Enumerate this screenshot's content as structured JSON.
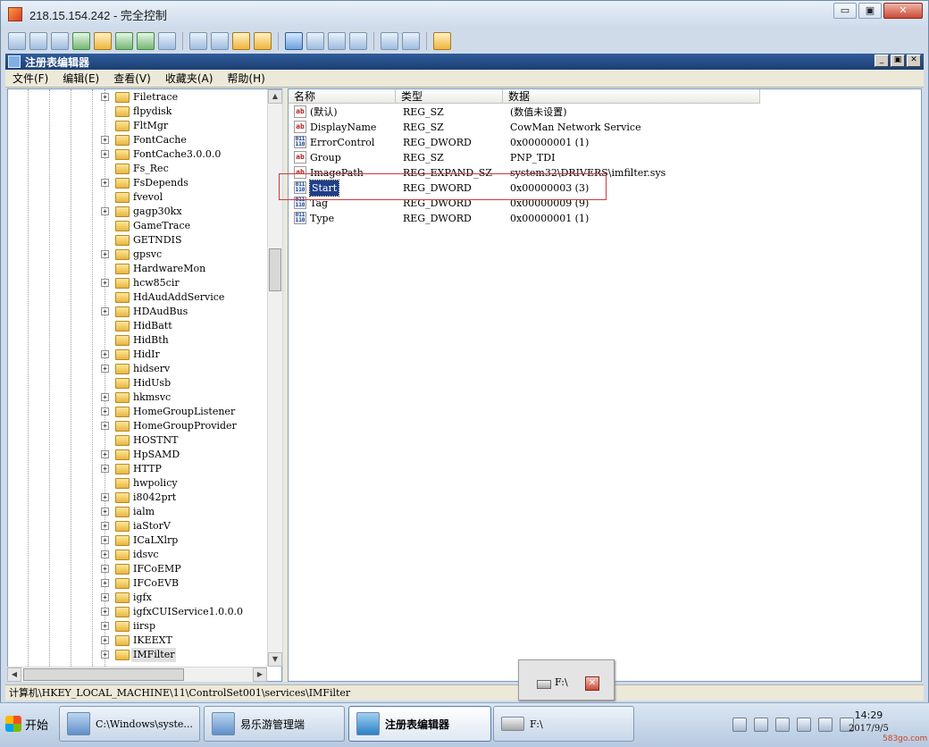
{
  "outer_window": {
    "title": "218.15.154.242 - 完全控制",
    "controls": {
      "minimize": "▭",
      "restore": "▣",
      "close": "✕"
    }
  },
  "inner_window": {
    "title": "注册表编辑器",
    "controls": {
      "minimize": "_",
      "restore": "▣",
      "close": "✕"
    }
  },
  "menu": [
    "文件(F)",
    "编辑(E)",
    "查看(V)",
    "收藏夹(A)",
    "帮助(H)"
  ],
  "tree": {
    "items": [
      {
        "label": "Filetrace",
        "expandable": true
      },
      {
        "label": "flpydisk",
        "expandable": false
      },
      {
        "label": "FltMgr",
        "expandable": false
      },
      {
        "label": "FontCache",
        "expandable": true
      },
      {
        "label": "FontCache3.0.0.0",
        "expandable": true
      },
      {
        "label": "Fs_Rec",
        "expandable": false
      },
      {
        "label": "FsDepends",
        "expandable": true
      },
      {
        "label": "fvevol",
        "expandable": false
      },
      {
        "label": "gagp30kx",
        "expandable": true
      },
      {
        "label": "GameTrace",
        "expandable": false
      },
      {
        "label": "GETNDIS",
        "expandable": false
      },
      {
        "label": "gpsvc",
        "expandable": true
      },
      {
        "label": "HardwareMon",
        "expandable": false
      },
      {
        "label": "hcw85cir",
        "expandable": true
      },
      {
        "label": "HdAudAddService",
        "expandable": false
      },
      {
        "label": "HDAudBus",
        "expandable": true
      },
      {
        "label": "HidBatt",
        "expandable": false
      },
      {
        "label": "HidBth",
        "expandable": false
      },
      {
        "label": "HidIr",
        "expandable": true
      },
      {
        "label": "hidserv",
        "expandable": true
      },
      {
        "label": "HidUsb",
        "expandable": false
      },
      {
        "label": "hkmsvc",
        "expandable": true
      },
      {
        "label": "HomeGroupListener",
        "expandable": true
      },
      {
        "label": "HomeGroupProvider",
        "expandable": true
      },
      {
        "label": "HOSTNT",
        "expandable": false
      },
      {
        "label": "HpSAMD",
        "expandable": true
      },
      {
        "label": "HTTP",
        "expandable": true
      },
      {
        "label": "hwpolicy",
        "expandable": false
      },
      {
        "label": "i8042prt",
        "expandable": true
      },
      {
        "label": "ialm",
        "expandable": true
      },
      {
        "label": "iaStorV",
        "expandable": true
      },
      {
        "label": "ICaLXlrp",
        "expandable": true
      },
      {
        "label": "idsvc",
        "expandable": true
      },
      {
        "label": "IFCoEMP",
        "expandable": true
      },
      {
        "label": "IFCoEVB",
        "expandable": true
      },
      {
        "label": "igfx",
        "expandable": true
      },
      {
        "label": "igfxCUIService1.0.0.0",
        "expandable": true
      },
      {
        "label": "iirsp",
        "expandable": true
      },
      {
        "label": "IKEEXT",
        "expandable": true
      },
      {
        "label": "IMFilter",
        "expandable": true,
        "selected": true
      }
    ]
  },
  "list": {
    "headers": [
      "名称",
      "类型",
      "数据"
    ],
    "rows": [
      {
        "icon": "ab",
        "name": "(默认)",
        "type": "REG_SZ",
        "data": "(数值未设置)"
      },
      {
        "icon": "ab",
        "name": "DisplayName",
        "type": "REG_SZ",
        "data": "CowMan Network Service"
      },
      {
        "icon": "dword",
        "name": "ErrorControl",
        "type": "REG_DWORD",
        "data": "0x00000001 (1)"
      },
      {
        "icon": "ab",
        "name": "Group",
        "type": "REG_SZ",
        "data": "PNP_TDI"
      },
      {
        "icon": "ab",
        "name": "ImagePath",
        "type": "REG_EXPAND_SZ",
        "data": "system32\\DRIVERS\\imfilter.sys"
      },
      {
        "icon": "dword",
        "name": "Start",
        "type": "REG_DWORD",
        "data": "0x00000003 (3)",
        "selected": true
      },
      {
        "icon": "dword",
        "name": "Tag",
        "type": "REG_DWORD",
        "data": "0x00000009 (9)"
      },
      {
        "icon": "dword",
        "name": "Type",
        "type": "REG_DWORD",
        "data": "0x00000001 (1)"
      }
    ]
  },
  "statusbar": "计算机\\HKEY_LOCAL_MACHINE\\11\\ControlSet001\\services\\IMFilter",
  "popup": {
    "label": "F:\\",
    "close": "✕"
  },
  "taskbar": {
    "start_label": "开始",
    "tasks": [
      {
        "label": "C:\\Windows\\syste...",
        "icon": "cmd"
      },
      {
        "label": "易乐游管理端",
        "icon": "network"
      },
      {
        "label": "注册表编辑器",
        "icon": "regedit",
        "active": true
      },
      {
        "label": "F:\\",
        "icon": "drive"
      }
    ],
    "clock": {
      "time": "14:29",
      "date": "2017/9/5"
    }
  },
  "watermark": "583go.com",
  "colors": {
    "title_bar": "#1d3f73",
    "selection": "#1e3f8a",
    "highlight_box": "#d0383a"
  }
}
